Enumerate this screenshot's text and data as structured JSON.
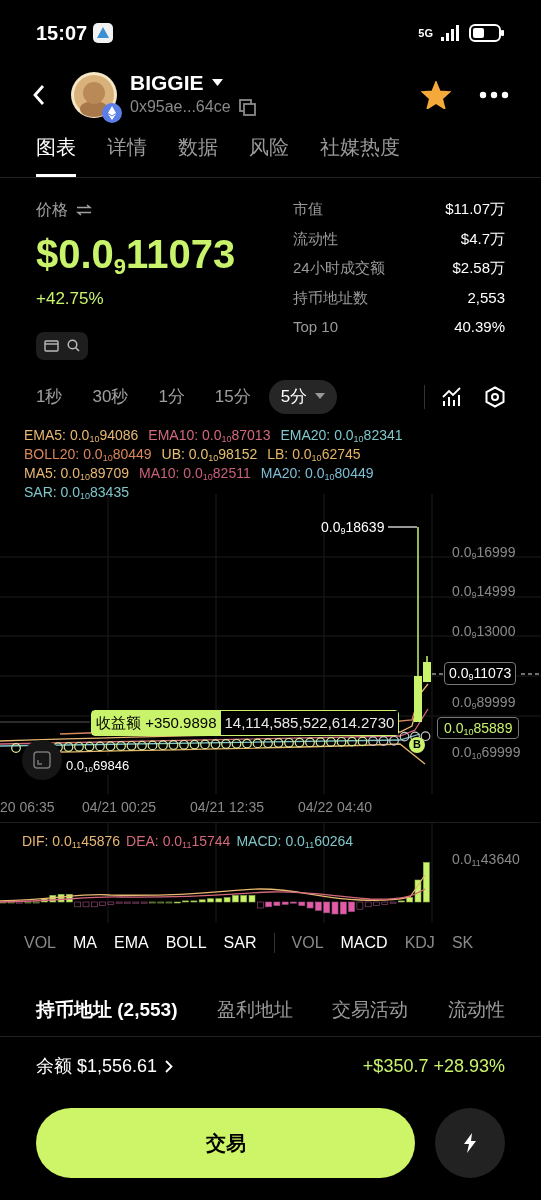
{
  "status_bar": {
    "time": "15:07",
    "network": "5G"
  },
  "header": {
    "token": "BIGGIE",
    "address": "0x95ae...64ce",
    "favorite": true
  },
  "tabs": [
    {
      "label": "图表",
      "selected": true
    },
    {
      "label": "详情",
      "selected": false
    },
    {
      "label": "数据",
      "selected": false
    },
    {
      "label": "风险",
      "selected": false
    },
    {
      "label": "社媒热度",
      "selected": false
    }
  ],
  "price": {
    "label": "价格",
    "value": "$0.0$_{9}$11073",
    "change": "+42.75%"
  },
  "stats": [
    {
      "label": "市值",
      "value": "$11.07万"
    },
    {
      "label": "流动性",
      "value": "$4.7万"
    },
    {
      "label": "24小时成交额",
      "value": "$2.58万"
    },
    {
      "label": "持币地址数",
      "value": "2,553"
    },
    {
      "label": "Top 10",
      "value": "40.39%"
    }
  ],
  "timeframes": [
    {
      "label": "1秒",
      "selected": false
    },
    {
      "label": "30秒",
      "selected": false
    },
    {
      "label": "1分",
      "selected": false
    },
    {
      "label": "15分",
      "selected": false
    },
    {
      "label": "5分",
      "selected": true
    }
  ],
  "indicator_legend": [
    [
      {
        "text": "EMA5: 0.0$_{10}$94086",
        "color": "#e9b872"
      },
      {
        "text": "EMA10: 0.0$_{10}$87013",
        "color": "#d4687c"
      },
      {
        "text": "EMA20: 0.0$_{10}$82341",
        "color": "#7fc7cb"
      }
    ],
    [
      {
        "text": "BOLL20: 0.0$_{10}$80449",
        "color": "#d9875a"
      },
      {
        "text": "UB: 0.0$_{10}$98152",
        "color": "#e8c070"
      },
      {
        "text": "LB: 0.0$_{10}$62745",
        "color": "#e6b566"
      }
    ],
    [
      {
        "text": "MA5: 0.0$_{10}$89709",
        "color": "#e9b872"
      },
      {
        "text": "MA10: 0.0$_{10}$82511",
        "color": "#c9607a"
      },
      {
        "text": "MA20: 0.0$_{10}$80449",
        "color": "#7fbfd6"
      }
    ],
    [
      {
        "text": "SAR: 0.0$_{10}$83435",
        "color": "#7fc7cb"
      }
    ]
  ],
  "chart": {
    "high_label": "0.0$_{9}$18639",
    "axis_labels": [
      "0.0$_{9}$16999",
      "0.0$_{9}$14999",
      "0.0$_{9}$13000",
      "0.0$_{9}$89999",
      "0.0$_{10}$69999"
    ],
    "current_price": "0.0$_{9}$11073",
    "marker_price": "0.0$_{10}$85889",
    "position_label": "收益额 +350.9898",
    "position_amount": "14,114,585,522,614.2730",
    "buy_marker": "B",
    "left_label": "0.0$_{10}$69846",
    "time_labels": [
      "20 06:35",
      "04/21 00:25",
      "04/21 12:35",
      "04/22 04:40"
    ]
  },
  "macd": {
    "legend": [
      {
        "text": "DIF: 0.0$_{11}$45876",
        "color": "#e9b872"
      },
      {
        "text": "DEA: 0.0$_{11}$15744",
        "color": "#d4687c"
      },
      {
        "text": "MACD: 0.0$_{11}$60264",
        "color": "#7fc7cb"
      }
    ],
    "axis_label": "0.0$_{11}$43640"
  },
  "main_indicators": [
    {
      "label": "VOL",
      "selected": false
    },
    {
      "label": "MA",
      "selected": true
    },
    {
      "label": "EMA",
      "selected": true
    },
    {
      "label": "BOLL",
      "selected": true
    },
    {
      "label": "SAR",
      "selected": true
    }
  ],
  "sub_indicators": [
    {
      "label": "VOL",
      "selected": false
    },
    {
      "label": "MACD",
      "selected": true
    },
    {
      "label": "KDJ",
      "selected": false
    },
    {
      "label": "SK",
      "selected": false
    }
  ],
  "holder_tabs": [
    {
      "label": "持币地址 (2,553)",
      "selected": true
    },
    {
      "label": "盈利地址",
      "selected": false
    },
    {
      "label": "交易活动",
      "selected": false
    },
    {
      "label": "流动性",
      "selected": false
    }
  ],
  "balance": {
    "label": "余额 $1,556.61",
    "pnl": "+$350.7 +28.93%"
  },
  "trade_button": "交易"
}
